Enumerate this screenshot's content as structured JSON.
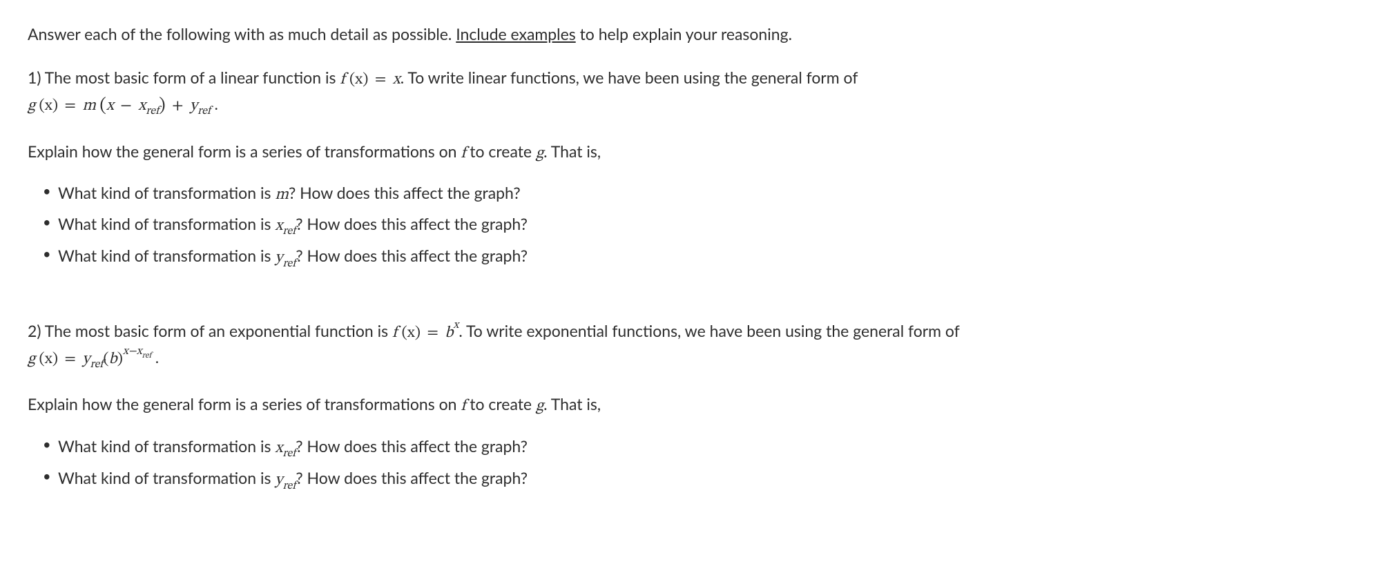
{
  "instruction": {
    "prefix": "Answer each of the following with as much detail as possible. ",
    "emphasis": "Include examples",
    "suffix": " to help explain your reasoning."
  },
  "q1": {
    "number": "1)",
    "intro_a": " The most basic form of a linear function is ",
    "eq1_lhs": "f ",
    "eq1_px": "(x)",
    "eq1_eq": " = ",
    "eq1_rhs": "x",
    "intro_b": ". To write linear functions, we have been using the general form of",
    "eq2_lhs": "g ",
    "eq2_px": "(x)",
    "eq2_eq": " = ",
    "eq2_m": "m ",
    "eq2_lp": "(",
    "eq2_x": "x",
    "eq2_minus": " − ",
    "eq2_xref_x": "x",
    "eq2_xref_sub": "ref",
    "eq2_rp": ")",
    "eq2_plus": " + ",
    "eq2_yref_y": "y",
    "eq2_yref_sub": "ref",
    "eq2_end": " .",
    "explain_a": "Explain how the general form is a series of transformations on ",
    "explain_f": "f",
    "explain_b": " to create ",
    "explain_g": "g",
    "explain_c": ". That is,",
    "bullets": {
      "b1_a": "What kind of transformation is ",
      "b1_m": "m",
      "b1_b": "? How does this affect the graph?",
      "b2_a": "What kind of transformation is ",
      "b2_x": "x",
      "b2_sub": "ref",
      "b2_b": "? How does this affect the graph?",
      "b3_a": "What kind of transformation is ",
      "b3_y": "y",
      "b3_sub": "ref",
      "b3_b": "? How does this affect the graph?"
    }
  },
  "q2": {
    "number": "2)",
    "intro_a": " The most basic form of an exponential function is ",
    "eq1_lhs": "f ",
    "eq1_px": "(x)",
    "eq1_eq": " = ",
    "eq1_b": "b",
    "eq1_sup": "x",
    "intro_b": ". To write exponential functions, we have been using the general form of",
    "eq2_lhs": "g ",
    "eq2_px": "(x)",
    "eq2_eq": " = ",
    "eq2_yref_y": "y",
    "eq2_yref_sub": "ref",
    "eq2_lp": "(",
    "eq2_b": "b",
    "eq2_rp": ")",
    "eq2_sup_x": "x",
    "eq2_sup_minus": "−",
    "eq2_sup_xr": "x",
    "eq2_sup_sub": "ref",
    "eq2_end": " .",
    "explain_a": "Explain how the general form is a series of transformations on ",
    "explain_f": "f",
    "explain_b": " to create ",
    "explain_g": "g",
    "explain_c": ". That is,",
    "bullets": {
      "b1_a": "What kind of transformation is ",
      "b1_x": "x",
      "b1_sub": "ref",
      "b1_b": "? How does this affect the graph?",
      "b2_a": "What kind of transformation is ",
      "b2_y": "y",
      "b2_sub": "ref",
      "b2_b": "? How does this affect the graph?"
    }
  }
}
